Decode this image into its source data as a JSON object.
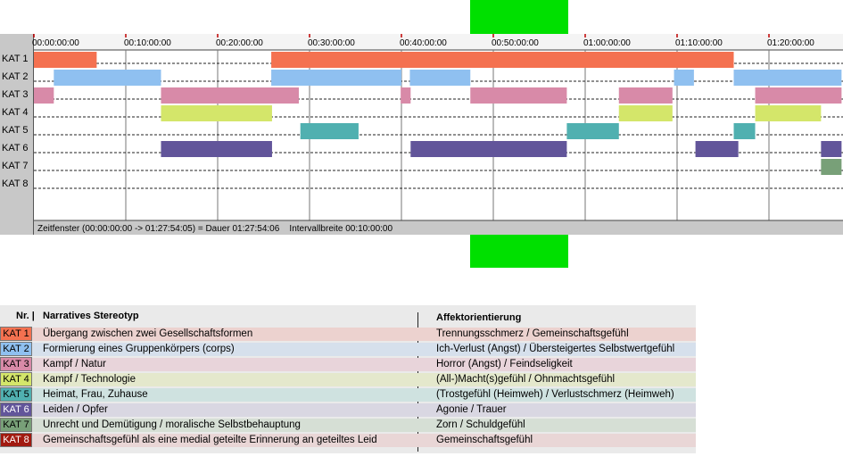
{
  "colors": {
    "green_bar": "#00e000",
    "KAT 1": "#f47150",
    "KAT 2": "#8fc0f0",
    "KAT 3": "#d88aa8",
    "KAT 4": "#d4e66a",
    "KAT 5": "#50b0b0",
    "KAT 6": "#62559a",
    "KAT 7": "#78a078",
    "KAT 8": "#a11a10"
  },
  "chart_data": {
    "type": "timeline",
    "x_unit": "time",
    "xlim": [
      "00:00:00:00",
      "01:27:54:05"
    ],
    "ticks": [
      "00:00:00:00",
      "00:10:00:00",
      "00:20:00:00",
      "00:30:00:00",
      "00:40:00:00",
      "00:50:00:00",
      "01:00:00:00",
      "01:10:00:00",
      "01:20:00:00"
    ],
    "rows": [
      "KAT 1",
      "KAT 2",
      "KAT 3",
      "KAT 4",
      "KAT 5",
      "KAT 6",
      "KAT 7",
      "KAT 8"
    ],
    "segments": [
      {
        "row": "KAT 1",
        "start": "00:00:00",
        "end": "00:06:50"
      },
      {
        "row": "KAT 1",
        "start": "00:25:50",
        "end": "01:16:10"
      },
      {
        "row": "KAT 2",
        "start": "00:02:10",
        "end": "00:13:50"
      },
      {
        "row": "KAT 2",
        "start": "00:25:50",
        "end": "00:40:00"
      },
      {
        "row": "KAT 2",
        "start": "00:40:55",
        "end": "00:47:30"
      },
      {
        "row": "KAT 2",
        "start": "01:09:40",
        "end": "01:11:50"
      },
      {
        "row": "KAT 2",
        "start": "01:16:10",
        "end": "01:27:54"
      },
      {
        "row": "KAT 3",
        "start": "00:00:00",
        "end": "00:02:10"
      },
      {
        "row": "KAT 3",
        "start": "00:13:50",
        "end": "00:28:50"
      },
      {
        "row": "KAT 3",
        "start": "00:39:55",
        "end": "00:41:00"
      },
      {
        "row": "KAT 3",
        "start": "00:47:30",
        "end": "00:58:00"
      },
      {
        "row": "KAT 3",
        "start": "01:03:40",
        "end": "01:09:30"
      },
      {
        "row": "KAT 3",
        "start": "01:18:30",
        "end": "01:27:54"
      },
      {
        "row": "KAT 4",
        "start": "00:13:50",
        "end": "00:25:55"
      },
      {
        "row": "KAT 4",
        "start": "01:03:40",
        "end": "01:09:30"
      },
      {
        "row": "KAT 4",
        "start": "01:18:30",
        "end": "01:25:40"
      },
      {
        "row": "KAT 5",
        "start": "00:29:00",
        "end": "00:35:20"
      },
      {
        "row": "KAT 5",
        "start": "00:58:00",
        "end": "01:03:40"
      },
      {
        "row": "KAT 5",
        "start": "01:16:10",
        "end": "01:18:30"
      },
      {
        "row": "KAT 6",
        "start": "00:13:50",
        "end": "00:25:55"
      },
      {
        "row": "KAT 6",
        "start": "00:41:00",
        "end": "00:58:00"
      },
      {
        "row": "KAT 6",
        "start": "01:12:00",
        "end": "01:16:40"
      },
      {
        "row": "KAT 6",
        "start": "01:25:40",
        "end": "01:27:54"
      },
      {
        "row": "KAT 7",
        "start": "01:25:40",
        "end": "01:27:54"
      }
    ],
    "status_text": "Zeitfenster (00:00:00:00 -> 01:27:54:05) = Dauer 01:27:54:06    Intervallbreite 00:10:00:00"
  },
  "legend": {
    "header_nr": "Nr.",
    "header_stereotyp": "Narratives Stereotyp",
    "header_affekt": "Affektorientierung",
    "rows": [
      {
        "kat": "KAT 1",
        "band": "#ecd2cf",
        "desc": "Übergang zwischen zwei Gesellschaftsformen",
        "affekt": "Trennungsschmerz / Gemeinschaftsgefühl"
      },
      {
        "kat": "KAT 2",
        "band": "#d6e0ec",
        "desc": "Formierung eines Gruppenkörpers (corps)",
        "affekt": "Ich-Verlust (Angst) / Übersteigertes Selbstwertgefühl"
      },
      {
        "kat": "KAT 3",
        "band": "#e8d4da",
        "desc": "Kampf / Natur",
        "affekt": "Horror (Angst) / Feindseligkeit"
      },
      {
        "kat": "KAT 4",
        "band": "#e4e8cc",
        "desc": "Kampf / Technologie",
        "affekt": "(All-)Macht(s)gefühl / Ohnmachtsgefühl"
      },
      {
        "kat": "KAT 5",
        "band": "#cfe2e0",
        "desc": "Heimat, Frau, Zuhause",
        "affekt": "(Trostgefühl (Heimweh) / Verlustschmerz (Heimweh)"
      },
      {
        "kat": "KAT 6",
        "band": "#d9d7e2",
        "desc": "Leiden / Opfer",
        "affekt": "Agonie / Trauer"
      },
      {
        "kat": "KAT 7",
        "band": "#d6dfd5",
        "desc": "Unrecht und Demütigung / moralische Selbstbehauptung",
        "affekt": "Zorn / Schuldgefühl"
      },
      {
        "kat": "KAT 8",
        "band": "#e9d6d6",
        "desc": "Gemeinschaftsgefühl als eine medial geteilte Erinnerung an geteiltes Leid",
        "affekt": "Gemeinschaftsgefühl"
      }
    ]
  }
}
